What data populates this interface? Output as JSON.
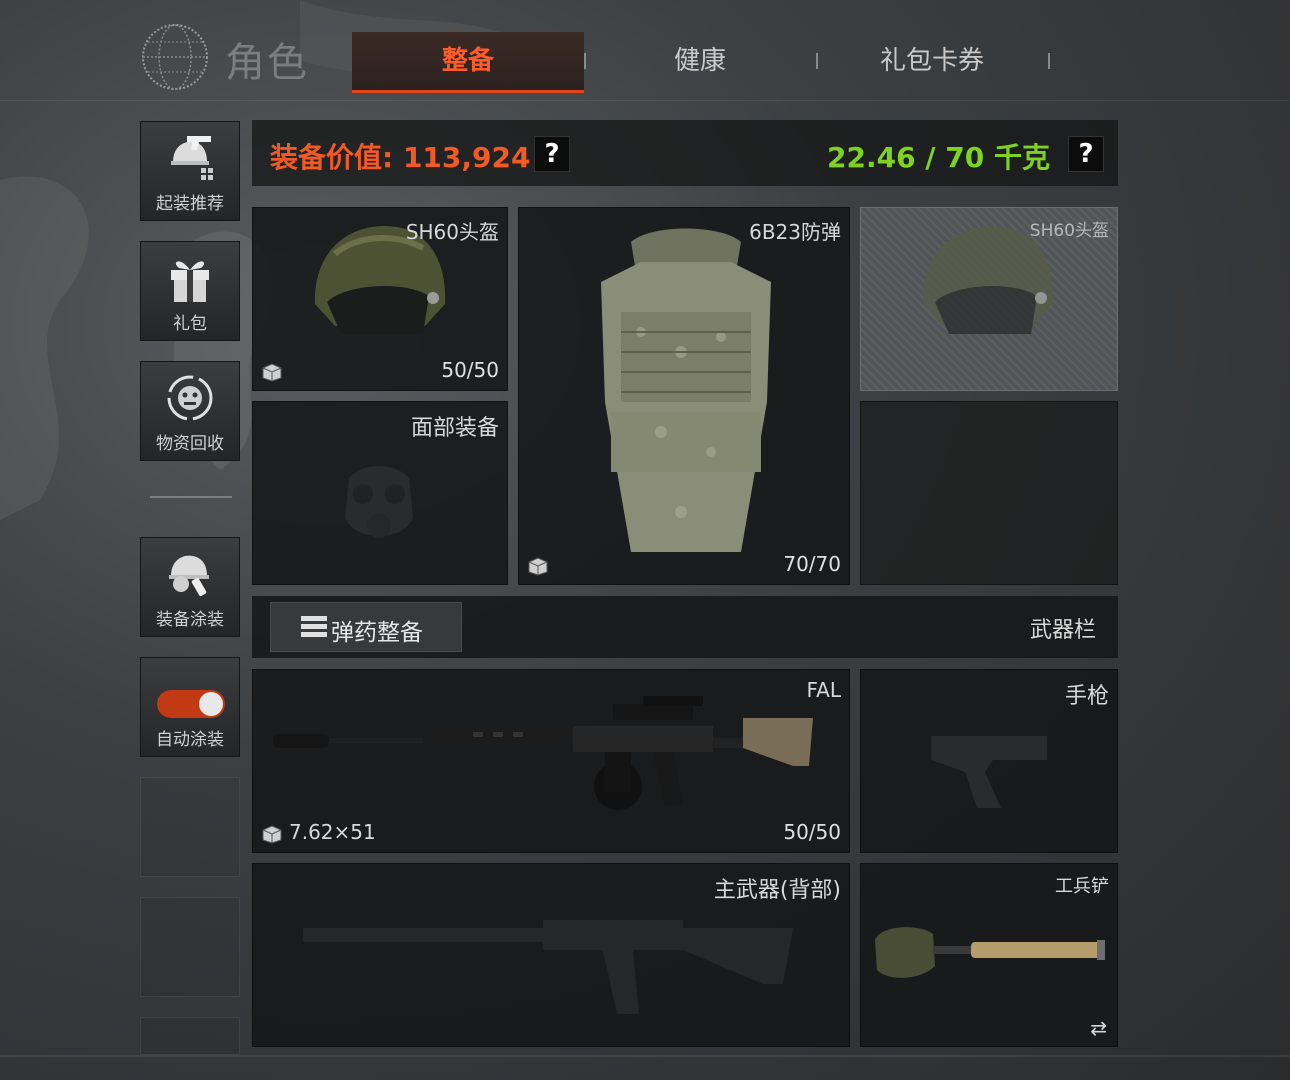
{
  "header": {
    "title": "角色",
    "tabs": [
      {
        "label": "整备",
        "active": true
      },
      {
        "label": "健康",
        "active": false
      },
      {
        "label": "礼包卡券",
        "active": false
      }
    ]
  },
  "sidebar": {
    "items": [
      {
        "label": "起装推荐",
        "icon": "helmet-gun-icon"
      },
      {
        "label": "礼包",
        "icon": "gift-icon"
      },
      {
        "label": "物资回收",
        "icon": "recycle-face-icon"
      },
      {
        "label": "装备涂装",
        "icon": "spray-helmet-icon"
      },
      {
        "label": "自动涂装",
        "toggle_on": true
      }
    ]
  },
  "summary": {
    "value_label": "装备价值: 113,924",
    "weight_label": "22.46 / 70 千克",
    "help": "?",
    "colors": {
      "value": "#f15a24",
      "weight": "#7ed321",
      "accent": "#e2441a"
    }
  },
  "slots": {
    "helmet": {
      "name": "SH60头盔",
      "count": "50/50"
    },
    "armor": {
      "name": "6B23防弹",
      "count": "70/70"
    },
    "helmet_preview": {
      "name": "SH60头盔"
    },
    "face": {
      "name": "面部装备"
    }
  },
  "weapons": {
    "ammo_button": "弹药整备",
    "bar_label": "武器栏",
    "primary": {
      "name": "FAL",
      "ammo": "7.62×51",
      "count": "50/50"
    },
    "pistol": {
      "name": "手枪"
    },
    "primary_back": {
      "name": "主武器(背部)"
    },
    "melee": {
      "name": "工兵铲",
      "swap": "⇄"
    }
  }
}
